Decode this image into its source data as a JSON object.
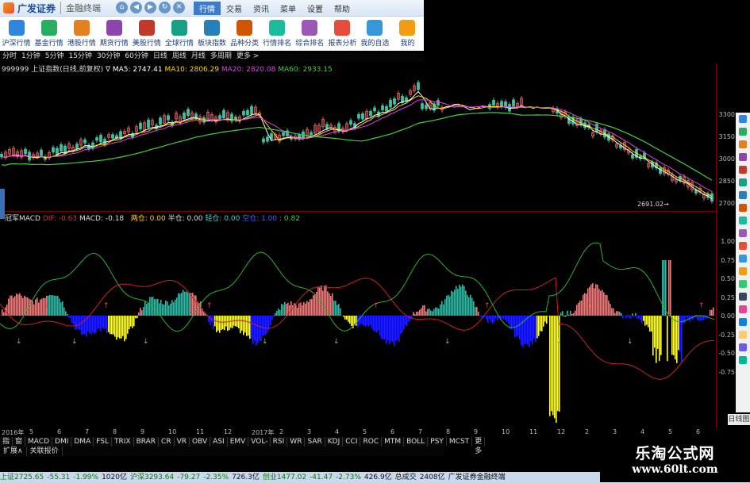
{
  "app": {
    "logo": "广发证券",
    "terminal": "金融终端"
  },
  "menus": [
    {
      "label": "行情",
      "active": true
    },
    {
      "label": "交易",
      "active": false
    },
    {
      "label": "资讯",
      "active": false
    },
    {
      "label": "菜单",
      "active": false
    },
    {
      "label": "设置",
      "active": false
    },
    {
      "label": "帮助",
      "active": false
    }
  ],
  "toolbar": [
    {
      "label": "沪深行情",
      "color": "#2e86de"
    },
    {
      "label": "基金行情",
      "color": "#27ae60"
    },
    {
      "label": "港股行情",
      "color": "#e67e22"
    },
    {
      "label": "期货行情",
      "color": "#8e44ad"
    },
    {
      "label": "美股行情",
      "color": "#c0392b"
    },
    {
      "label": "全球行情",
      "color": "#16a085"
    },
    {
      "label": "板块指数",
      "color": "#2980b9"
    },
    {
      "label": "品种分类",
      "color": "#d35400"
    },
    {
      "label": "行情排名",
      "color": "#1abc9c"
    },
    {
      "label": "综合排名",
      "color": "#9b59b6"
    },
    {
      "label": "报表分析",
      "color": "#e74c3c"
    },
    {
      "label": "我的自选",
      "color": "#3498db"
    },
    {
      "label": "我的",
      "color": "#f39c12"
    }
  ],
  "periods": [
    "分时",
    "1分钟",
    "5分钟",
    "15分钟",
    "30分钟",
    "60分钟",
    "日线",
    "周线",
    "月线",
    "多周期",
    "更多 >"
  ],
  "info": {
    "code": "999999 上证指数(日线,前复权) ∇",
    "ma5": "MA5: 2747.41",
    "ma10": "MA10: 2806.29",
    "ma20": "MA20: 2820.08",
    "ma60": "MA60: 2933.15"
  },
  "macd_info": {
    "name": "冠军MACD",
    "dif": "DIF: -0.63",
    "macd": "MACD: -0.18",
    "p1": "两仓: 0.00",
    "p2": "半仓: 0.00",
    "p3": "轻仓: 0.00",
    "p4": "空仓: 1.00",
    "p5": ": 0.82"
  },
  "price_label": "2691.02→",
  "y_main": [
    "3300",
    "3150",
    "3000",
    "2850",
    "2700"
  ],
  "y_sub": [
    "1.00",
    "0.75",
    "0.50",
    "0.25",
    "0.00",
    "-0.25",
    "-0.50",
    "-0.75"
  ],
  "x_axis": [
    "2016年",
    "5",
    "6",
    "7",
    "8",
    "9",
    "10",
    "11",
    "12",
    "2017年",
    "2",
    "3",
    "4",
    "5",
    "6",
    "7",
    "8",
    "9",
    "10",
    "11",
    "12",
    "2",
    "3",
    "4",
    "5",
    "6"
  ],
  "indicators": [
    "指标",
    "窗口",
    "MACD",
    "DMI",
    "DMA",
    "FSL",
    "TRIX",
    "BRAR",
    "CR",
    "VR",
    "OBV",
    "ASI",
    "EMV",
    "VOL-TDX",
    "RSI",
    "WR",
    "SAR",
    "KDJ",
    "CCI",
    "ROC",
    "MTM",
    "BOLL",
    "PSY",
    "MCST",
    "更多"
  ],
  "ext": [
    "扩展∧",
    "关联报价"
  ],
  "side_tab": "日线图",
  "status": [
    {
      "text": "上证2725.65",
      "color": "#0a7a0a"
    },
    {
      "text": "-55.31",
      "color": "#0a7a0a"
    },
    {
      "text": "-1.99%",
      "color": "#0a7a0a"
    },
    {
      "text": "1020亿",
      "color": "#111"
    },
    {
      "text": "沪深3293.64",
      "color": "#0a7a0a"
    },
    {
      "text": "-79.27",
      "color": "#0a7a0a"
    },
    {
      "text": "-2.35%",
      "color": "#0a7a0a"
    },
    {
      "text": "726.3亿",
      "color": "#111"
    },
    {
      "text": "创业1477.02",
      "color": "#0a7a0a"
    },
    {
      "text": "-41.47",
      "color": "#0a7a0a"
    },
    {
      "text": "-2.73%",
      "color": "#0a7a0a"
    },
    {
      "text": "426.9亿",
      "color": "#111"
    },
    {
      "text": "总成交",
      "color": "#111"
    },
    {
      "text": "2408亿",
      "color": "#111"
    },
    {
      "text": "广发证券金融终端",
      "color": "#111"
    }
  ],
  "watermark": {
    "line1": "乐淘公式网",
    "line2": "www.60lt.com"
  },
  "colors": {
    "candle_up": "#e06060",
    "candle_down": "#40c0a0",
    "ma5": "#ffffff",
    "ma10": "#ffd400",
    "ma20": "#e040e0",
    "ma60": "#40d040",
    "hist_pos": "#e08080",
    "hist_teal": "#40b0a0",
    "hist_neg": "#2020ff",
    "hist_yellow": "#ffff40",
    "dif": "#d02020",
    "dea": "#30b030"
  }
}
